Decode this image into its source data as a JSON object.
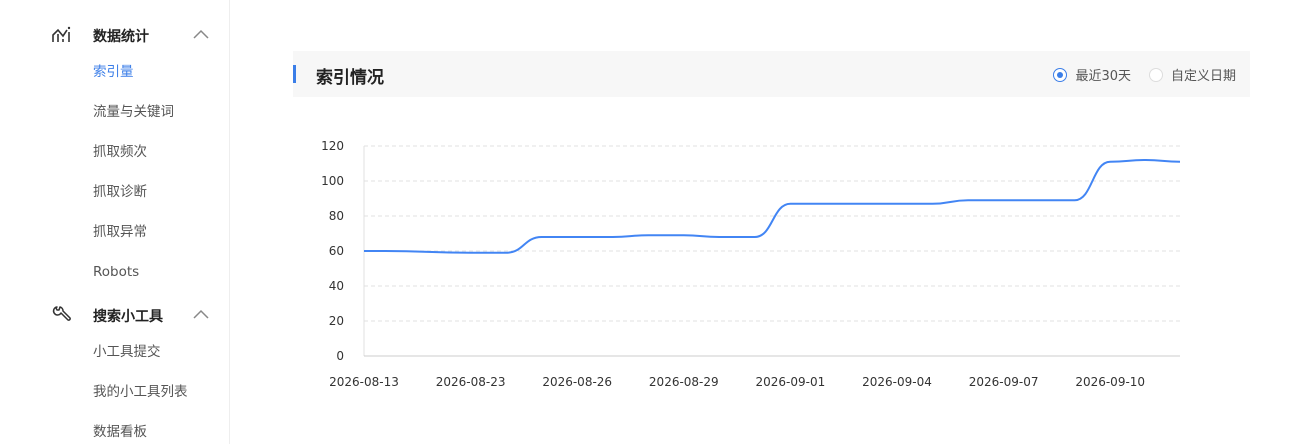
{
  "sidebar": {
    "sections": [
      {
        "title": "数据统计",
        "icon": "line-chart-icon",
        "expanded": true,
        "items": [
          {
            "label": "索引量",
            "active": true
          },
          {
            "label": "流量与关键词",
            "active": false
          },
          {
            "label": "抓取频次",
            "active": false
          },
          {
            "label": "抓取诊断",
            "active": false
          },
          {
            "label": "抓取异常",
            "active": false
          },
          {
            "label": "Robots",
            "active": false
          }
        ]
      },
      {
        "title": "搜索小工具",
        "icon": "wrench-icon",
        "expanded": true,
        "items": [
          {
            "label": "小工具提交",
            "active": false
          },
          {
            "label": "我的小工具列表",
            "active": false
          },
          {
            "label": "数据看板",
            "active": false
          }
        ]
      }
    ]
  },
  "panel": {
    "title": "索引情况",
    "range_options": [
      {
        "label": "最近30天",
        "checked": true
      },
      {
        "label": "自定义日期",
        "checked": false
      }
    ]
  },
  "colors": {
    "accent": "#3b7ee8",
    "line": "#4285f4",
    "grid": "#e0e0e0"
  },
  "chart_data": {
    "type": "line",
    "title": "",
    "xlabel": "",
    "ylabel": "",
    "ylim": [
      0,
      120
    ],
    "yticks": [
      0,
      20,
      40,
      60,
      80,
      100,
      120
    ],
    "grid": true,
    "x_tick_labels": [
      "2026-08-13",
      "2026-08-23",
      "2026-08-26",
      "2026-08-29",
      "2026-09-01",
      "2026-09-04",
      "2026-09-07",
      "2026-09-10"
    ],
    "x": [
      "2026-08-13",
      "2026-08-14",
      "2026-08-15",
      "2026-08-23",
      "2026-08-24",
      "2026-08-25",
      "2026-08-26",
      "2026-08-27",
      "2026-08-28",
      "2026-08-29",
      "2026-08-30",
      "2026-08-31",
      "2026-09-01",
      "2026-09-02",
      "2026-09-03",
      "2026-09-04",
      "2026-09-05",
      "2026-09-06",
      "2026-09-07",
      "2026-09-08",
      "2026-09-09",
      "2026-09-10",
      "2026-09-11",
      "2026-09-12"
    ],
    "series": [
      {
        "values": [
          60,
          60,
          60,
          59,
          59,
          68,
          68,
          68,
          69,
          69,
          68,
          68,
          87,
          87,
          87,
          87,
          87,
          89,
          89,
          89,
          89,
          111,
          112,
          111
        ]
      }
    ]
  }
}
